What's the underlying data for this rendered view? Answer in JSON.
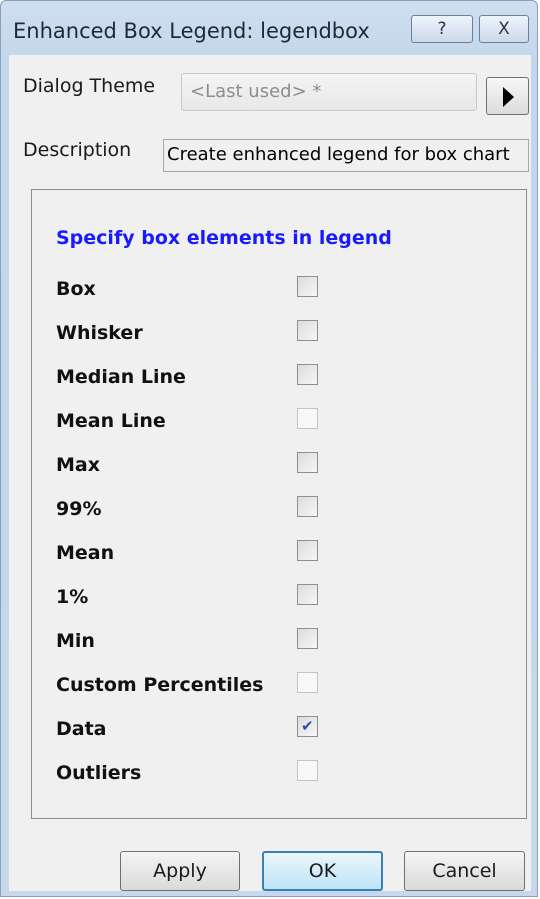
{
  "window": {
    "title": "Enhanced Box Legend: legendbox",
    "help_glyph": "?",
    "close_glyph": "X"
  },
  "dialog_theme": {
    "label": "Dialog Theme",
    "value": "<Last used> *"
  },
  "description": {
    "label": "Description",
    "value": "Create enhanced legend for box chart"
  },
  "section": {
    "heading": "Specify box elements in legend",
    "items": [
      {
        "label": "Box",
        "checked": false,
        "style": "normal"
      },
      {
        "label": "Whisker",
        "checked": false,
        "style": "normal"
      },
      {
        "label": "Median Line",
        "checked": false,
        "style": "normal"
      },
      {
        "label": "Mean Line",
        "checked": false,
        "style": "light"
      },
      {
        "label": "Max",
        "checked": false,
        "style": "normal"
      },
      {
        "label": "99%",
        "checked": false,
        "style": "normal"
      },
      {
        "label": "Mean",
        "checked": false,
        "style": "normal"
      },
      {
        "label": "1%",
        "checked": false,
        "style": "normal"
      },
      {
        "label": "Min",
        "checked": false,
        "style": "normal"
      },
      {
        "label": "Custom Percentiles",
        "checked": false,
        "style": "light"
      },
      {
        "label": "Data",
        "checked": true,
        "style": "normal"
      },
      {
        "label": "Outliers",
        "checked": false,
        "style": "light"
      }
    ]
  },
  "buttons": {
    "apply": "Apply",
    "ok": "OK",
    "cancel": "Cancel"
  },
  "colors": {
    "heading": "#1a1aff",
    "check": "#2d4ea8"
  }
}
